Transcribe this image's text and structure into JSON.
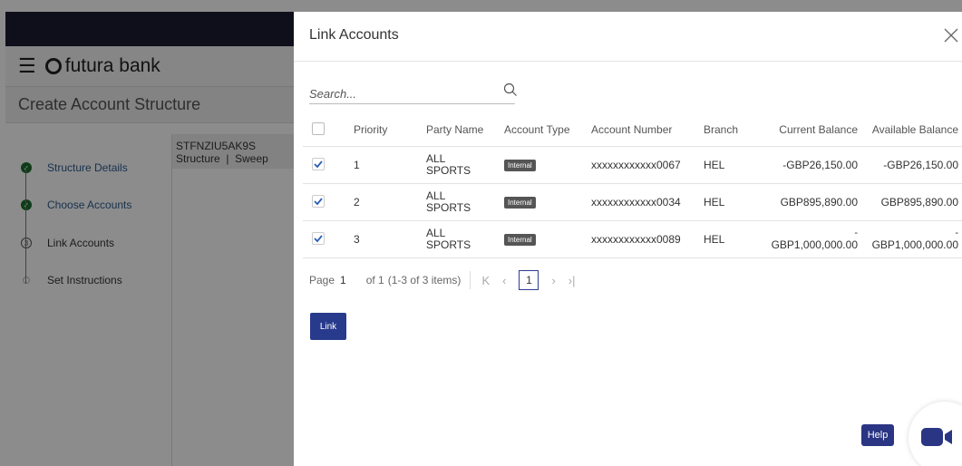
{
  "background": {
    "brand": "futura bank",
    "page_title": "Create Account Structure",
    "steps": [
      {
        "label": "Structure Details",
        "state": "done"
      },
      {
        "label": "Choose Accounts",
        "state": "done"
      },
      {
        "label": "Link Accounts",
        "state": "current",
        "number": "3"
      },
      {
        "label": "Set Instructions",
        "state": "todo"
      }
    ],
    "structure_code": "STFNZIU5AK9S",
    "structure_meta": "Structure  |  Sweep"
  },
  "modal": {
    "title": "Link Accounts",
    "search_placeholder": "Search...",
    "columns": {
      "priority": "Priority",
      "party": "Party Name",
      "type": "Account Type",
      "number": "Account Number",
      "branch": "Branch",
      "current": "Current Balance",
      "available": "Available Balance"
    },
    "rows": [
      {
        "priority": "1",
        "party_line1": "ALL",
        "party_line2": "SPORTS",
        "type": "Internal",
        "number": "xxxxxxxxxxxx0067",
        "branch": "HEL",
        "current": "-GBP26,150.00",
        "available": "-GBP26,150.00",
        "checked": true
      },
      {
        "priority": "2",
        "party_line1": "ALL",
        "party_line2": "SPORTS",
        "type": "Internal",
        "number": "xxxxxxxxxxxx0034",
        "branch": "HEL",
        "current": "GBP895,890.00",
        "available": "GBP895,890.00",
        "checked": true
      },
      {
        "priority": "3",
        "party_line1": "ALL",
        "party_line2": "SPORTS",
        "type": "Internal",
        "number": "xxxxxxxxxxxx0089",
        "branch": "HEL",
        "current_dash": "-",
        "current": "GBP1,000,000.00",
        "available_dash": "-",
        "available": "GBP1,000,000.00",
        "checked": true
      }
    ],
    "pager": {
      "page_label": "Page",
      "page": "1",
      "of": "of 1",
      "items": "(1-3 of 3 items)",
      "current_page": "1"
    },
    "link_button": "Link",
    "help_button": "Help"
  },
  "colors": {
    "accent": "#283a8c",
    "done_step": "#1c6e2f",
    "badge": "#555555"
  }
}
